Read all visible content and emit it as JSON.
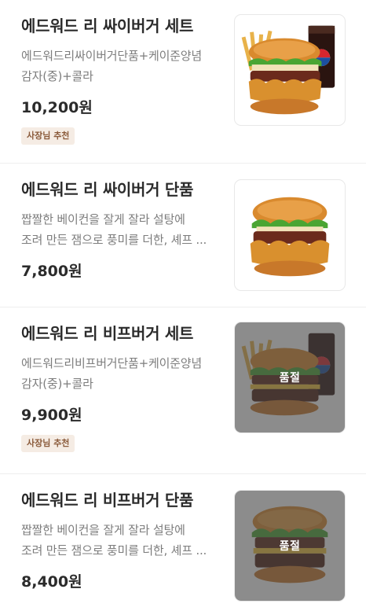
{
  "menu": {
    "items": [
      {
        "name": "에드워드 리 싸이버거 세트",
        "desc_line1": "에드워드리싸이버거단품+케이준양념",
        "desc_line2": "감자(중)+콜라",
        "price": "10,200원",
        "badge": "사장님 추천",
        "image": "chicken-burger-set-image",
        "sold_out": false
      },
      {
        "name": "에드워드 리 싸이버거 단품",
        "desc_line1": "짭짤한 베이컨을 잘게 잘라 설탕에",
        "desc_line2": "조려 만든 잼으로 풍미를 더한, 셰프 ...",
        "price": "7,800원",
        "image": "chicken-burger-image",
        "sold_out": false
      },
      {
        "name": "에드워드 리 비프버거 세트",
        "desc_line1": "에드워드리비프버거단품+케이준양념",
        "desc_line2": "감자(중)+콜라",
        "price": "9,900원",
        "badge": "사장님 추천",
        "image": "beef-burger-set-image",
        "sold_out": true,
        "sold_out_label": "품절"
      },
      {
        "name": "에드워드 리 비프버거 단품",
        "desc_line1": "짭짤한 베이컨을 잘게 잘라 설탕에",
        "desc_line2": "조려 만든 잼으로 풍미를 더한, 셰프 ...",
        "price": "8,400원",
        "image": "beef-burger-image",
        "sold_out": true,
        "sold_out_label": "품절"
      }
    ]
  },
  "colors": {
    "title": "#2b2b2b",
    "description": "#7d7d7d",
    "badge_text": "#8a5a3a",
    "badge_bg": "#f5ece4",
    "sold_out_overlay": "#464646",
    "pepsi_blue": "#1b4fa0",
    "pepsi_red": "#d7262e"
  }
}
